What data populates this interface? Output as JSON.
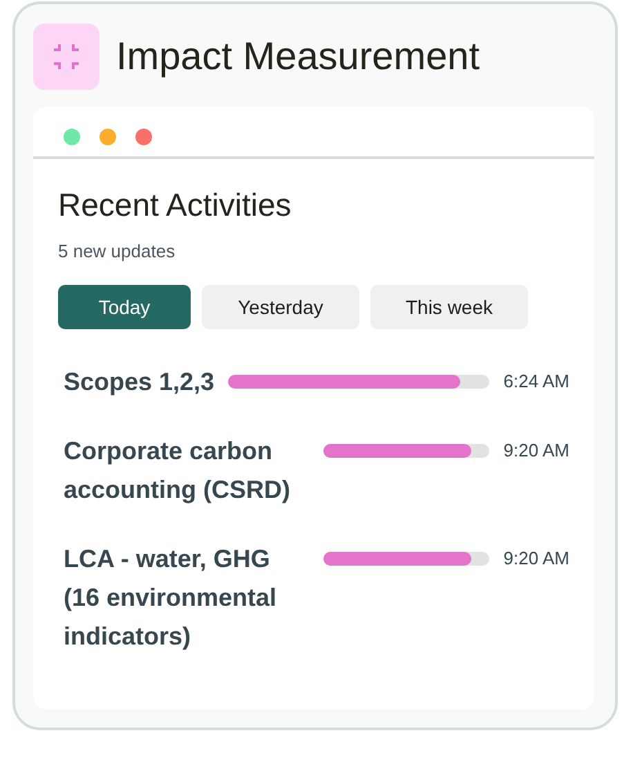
{
  "header": {
    "title": "Impact Measurement"
  },
  "window_dots": [
    {
      "color": "#6ee7a8"
    },
    {
      "color": "#fbad2b"
    },
    {
      "color": "#f87168"
    }
  ],
  "panel": {
    "title": "Recent Activities",
    "subtitle": "5 new updates"
  },
  "tabs": [
    {
      "label": "Today",
      "selected": true
    },
    {
      "label": "Yesterday",
      "selected": false
    },
    {
      "label": "This week",
      "selected": false
    }
  ],
  "activities": [
    {
      "name": "Scopes 1,2,3",
      "level": 0.89,
      "time": "6:24 AM"
    },
    {
      "name": "Corporate carbon accounting (CSRD)",
      "level": 0.89,
      "time": "9:20 AM"
    },
    {
      "name": "LCA - water, GHG (16 environmental indicators)",
      "level": 0.89,
      "time": "9:20 AM"
    }
  ]
}
